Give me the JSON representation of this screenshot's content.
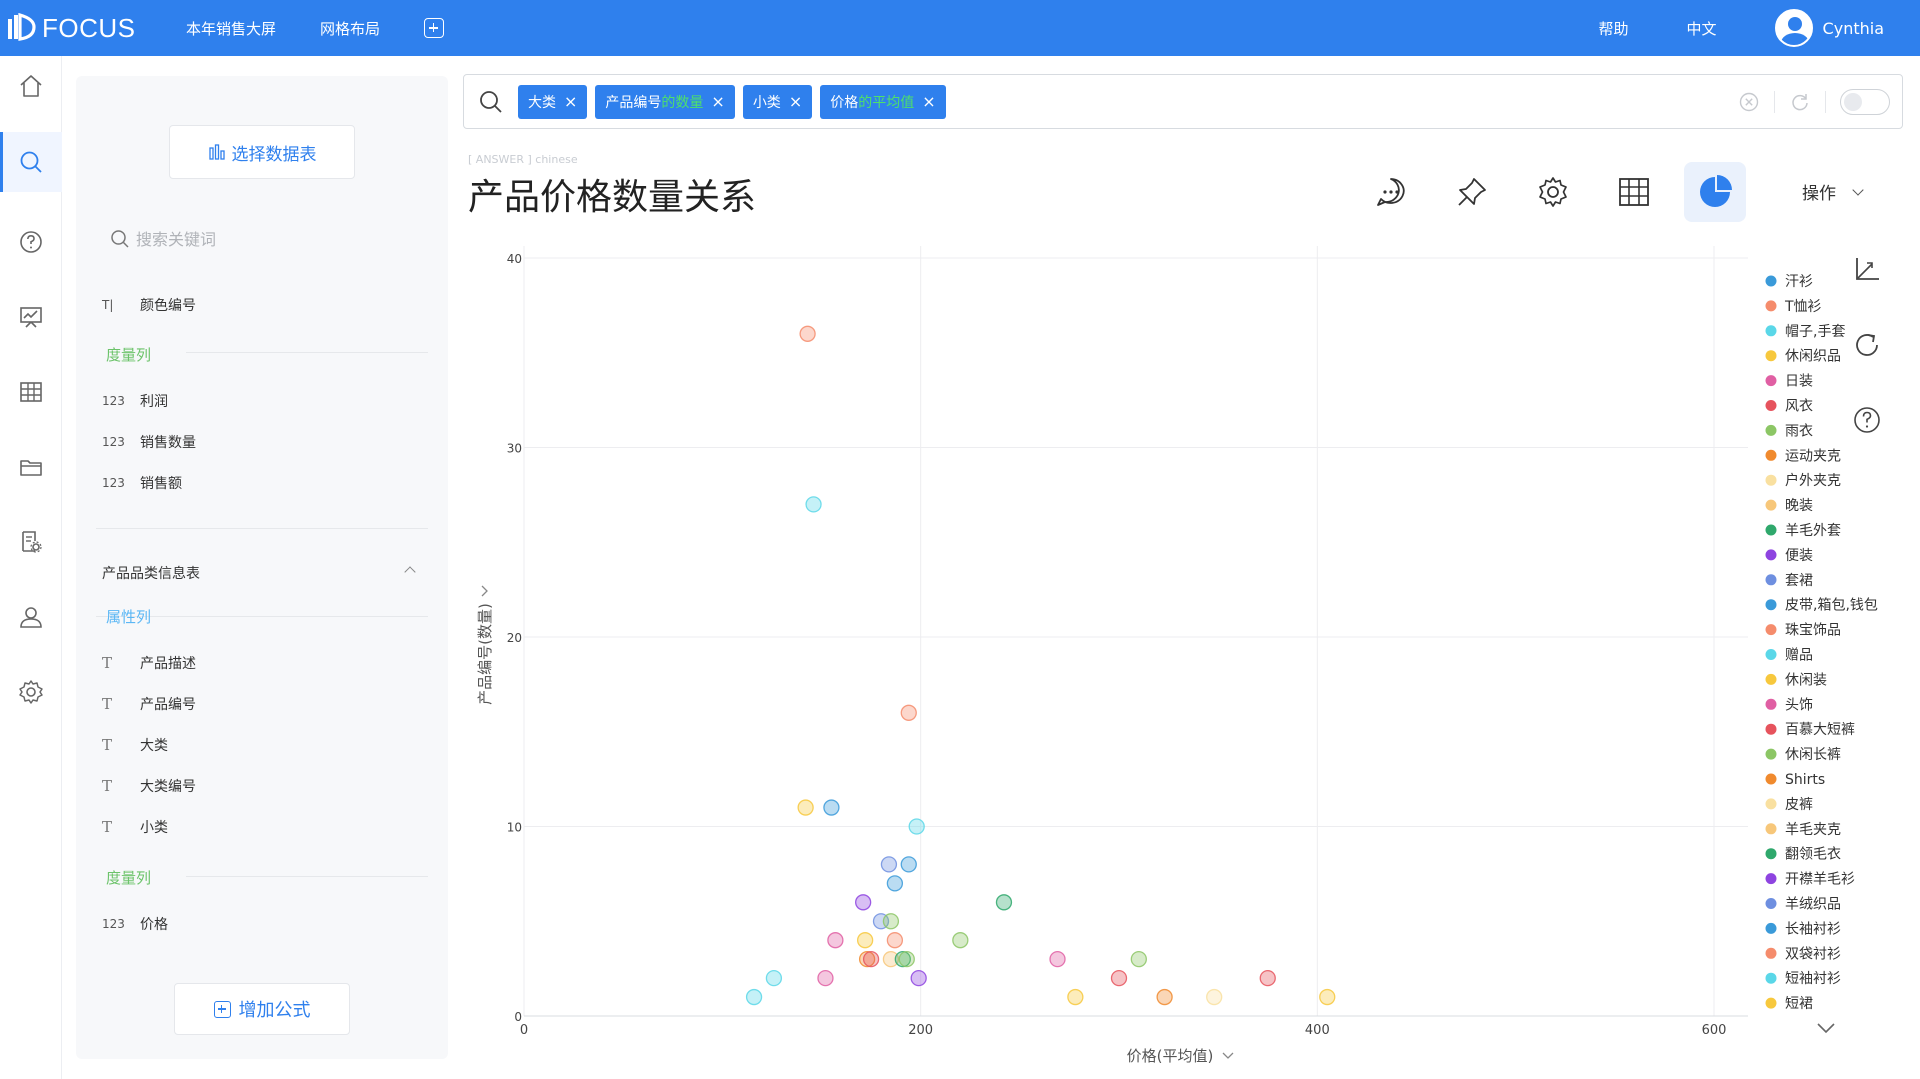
{
  "app": {
    "logo_text": "FOCUS",
    "nav": [
      "本年销售大屏",
      "网格布局"
    ],
    "help": "帮助",
    "language": "中文",
    "user_name": "Cynthia"
  },
  "rail": [
    "home-icon",
    "search-icon",
    "help-icon",
    "dashboard-icon",
    "table-icon",
    "folder-icon",
    "report-settings-icon",
    "user-icon",
    "settings-icon"
  ],
  "data_panel": {
    "select_table_label": "选择数据表",
    "search_placeholder": "搜索关键词",
    "top_item": {
      "type": "T|",
      "label": "颜色编号"
    },
    "metric_section_label": "度量列",
    "metrics_a": [
      {
        "type": "123",
        "label": "利润"
      },
      {
        "type": "123",
        "label": "销售数量"
      },
      {
        "type": "123",
        "label": "销售额"
      }
    ],
    "group_title": "产品品类信息表",
    "attribute_section_label": "属性列",
    "attributes": [
      {
        "type": "T",
        "label": "产品描述"
      },
      {
        "type": "T",
        "label": "产品编号"
      },
      {
        "type": "T",
        "label": "大类"
      },
      {
        "type": "T",
        "label": "大类编号"
      },
      {
        "type": "T",
        "label": "小类"
      }
    ],
    "metrics_b": [
      {
        "type": "123",
        "label": "价格"
      }
    ],
    "add_formula_label": "增加公式"
  },
  "search_tokens": [
    {
      "main": "大类",
      "suffix": ""
    },
    {
      "main": "产品编号",
      "suffix": "的数量"
    },
    {
      "main": "小类",
      "suffix": ""
    },
    {
      "main": "价格",
      "suffix": "的平均值"
    }
  ],
  "answer": {
    "tag": "[ ANSWER ] chinese",
    "title": "产品价格数量关系",
    "ops_label": "操作"
  },
  "toolbar_icons": [
    "comment-icon",
    "pin-icon",
    "settings-icon",
    "table-view-icon",
    "chart-view-icon"
  ],
  "colors": {
    "brand": "#2f80ed",
    "metric_green": "#6cc36a",
    "attr_blue": "#5bb7f5"
  },
  "chart_data": {
    "type": "scatter",
    "xlabel": "价格(平均值)",
    "ylabel": "产品编号(数量)",
    "xlim": [
      0,
      600
    ],
    "ylim": [
      0,
      40
    ],
    "xticks": [
      0,
      200,
      400,
      600
    ],
    "yticks": [
      0,
      10,
      20,
      30,
      40
    ],
    "grid": true,
    "legend_position": "right",
    "legend": [
      {
        "name": "汗衫",
        "color": "#3a9ad9"
      },
      {
        "name": "T恤衫",
        "color": "#f58c6c"
      },
      {
        "name": "帽子,手套",
        "color": "#5ad7e8"
      },
      {
        "name": "休闲织品",
        "color": "#f7c83d"
      },
      {
        "name": "日装",
        "color": "#e05fa3"
      },
      {
        "name": "风衣",
        "color": "#e6535d"
      },
      {
        "name": "雨衣",
        "color": "#8cc665"
      },
      {
        "name": "运动夹克",
        "color": "#f08a2e"
      },
      {
        "name": "户外夹克",
        "color": "#f9e0a0"
      },
      {
        "name": "晚装",
        "color": "#f7c77a"
      },
      {
        "name": "羊毛外套",
        "color": "#2fa86c"
      },
      {
        "name": "便装",
        "color": "#8e44e0"
      },
      {
        "name": "套裙",
        "color": "#6e8fe0"
      },
      {
        "name": "皮带,箱包,钱包",
        "color": "#3a9ad9"
      },
      {
        "name": "珠宝饰品",
        "color": "#f58c6c"
      },
      {
        "name": "赠品",
        "color": "#5ad7e8"
      },
      {
        "name": "休闲装",
        "color": "#f7c83d"
      },
      {
        "name": "头饰",
        "color": "#e05fa3"
      },
      {
        "name": "百慕大短裤",
        "color": "#e6535d"
      },
      {
        "name": "休闲长裤",
        "color": "#8cc665"
      },
      {
        "name": "Shirts",
        "color": "#f08a2e"
      },
      {
        "name": "皮裤",
        "color": "#f9e0a0"
      },
      {
        "name": "羊毛夹克",
        "color": "#f7c77a"
      },
      {
        "name": "翻领毛衣",
        "color": "#2fa86c"
      },
      {
        "name": "开襟羊毛衫",
        "color": "#8e44e0"
      },
      {
        "name": "羊绒织品",
        "color": "#6e8fe0"
      },
      {
        "name": "长袖衬衫",
        "color": "#3a9ad9"
      },
      {
        "name": "双袋衬衫",
        "color": "#f58c6c"
      },
      {
        "name": "短袖衬衫",
        "color": "#5ad7e8"
      },
      {
        "name": "短裙",
        "color": "#f7c83d"
      }
    ],
    "points": [
      {
        "x": 143,
        "y": 36,
        "color": "#f58c6c"
      },
      {
        "x": 146,
        "y": 27,
        "color": "#5ad7e8"
      },
      {
        "x": 194,
        "y": 16,
        "color": "#f58c6c"
      },
      {
        "x": 142,
        "y": 11,
        "color": "#f7c83d"
      },
      {
        "x": 155,
        "y": 11,
        "color": "#3a9ad9"
      },
      {
        "x": 198,
        "y": 10,
        "color": "#5ad7e8"
      },
      {
        "x": 184,
        "y": 8,
        "color": "#6e8fe0"
      },
      {
        "x": 194,
        "y": 8,
        "color": "#3a9ad9"
      },
      {
        "x": 187,
        "y": 7,
        "color": "#3a9ad9"
      },
      {
        "x": 171,
        "y": 6,
        "color": "#8e44e0"
      },
      {
        "x": 242,
        "y": 6,
        "color": "#2fa86c"
      },
      {
        "x": 180,
        "y": 5,
        "color": "#6e8fe0"
      },
      {
        "x": 185,
        "y": 5,
        "color": "#8cc665"
      },
      {
        "x": 157,
        "y": 4,
        "color": "#e05fa3"
      },
      {
        "x": 172,
        "y": 4,
        "color": "#f7c83d"
      },
      {
        "x": 187,
        "y": 4,
        "color": "#f58c6c"
      },
      {
        "x": 220,
        "y": 4,
        "color": "#8cc665"
      },
      {
        "x": 173,
        "y": 3,
        "color": "#f08a2e"
      },
      {
        "x": 175,
        "y": 3,
        "color": "#e6535d"
      },
      {
        "x": 185,
        "y": 3,
        "color": "#f7c77a"
      },
      {
        "x": 191,
        "y": 3,
        "color": "#2fa86c"
      },
      {
        "x": 193,
        "y": 3,
        "color": "#8cc665"
      },
      {
        "x": 269,
        "y": 3,
        "color": "#e05fa3"
      },
      {
        "x": 310,
        "y": 3,
        "color": "#8cc665"
      },
      {
        "x": 126,
        "y": 2,
        "color": "#5ad7e8"
      },
      {
        "x": 152,
        "y": 2,
        "color": "#e05fa3"
      },
      {
        "x": 199,
        "y": 2,
        "color": "#8e44e0"
      },
      {
        "x": 300,
        "y": 2,
        "color": "#e6535d"
      },
      {
        "x": 375,
        "y": 2,
        "color": "#e6535d"
      },
      {
        "x": 116,
        "y": 1,
        "color": "#5ad7e8"
      },
      {
        "x": 278,
        "y": 1,
        "color": "#f7c83d"
      },
      {
        "x": 323,
        "y": 1,
        "color": "#f08a2e"
      },
      {
        "x": 348,
        "y": 1,
        "color": "#f9e0a0"
      },
      {
        "x": 405,
        "y": 1,
        "color": "#f7c83d"
      }
    ]
  }
}
